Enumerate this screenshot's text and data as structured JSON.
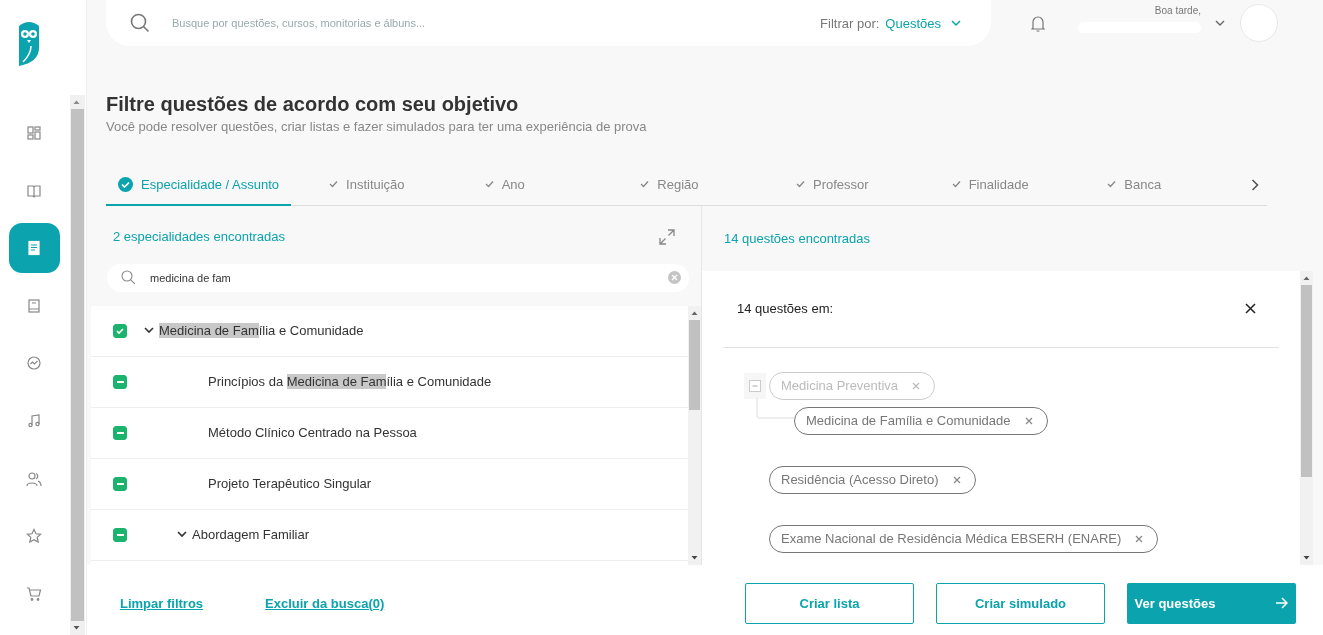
{
  "sidebar": {
    "items": [
      {
        "selected": false
      },
      {
        "selected": false
      },
      {
        "selected": true
      },
      {
        "selected": false
      },
      {
        "selected": false
      },
      {
        "selected": false
      },
      {
        "selected": false
      },
      {
        "selected": false
      },
      {
        "selected": false
      }
    ]
  },
  "top_bar": {
    "search": {
      "placeholder": "Busque por questões, cursos, monitorias e álbuns..."
    },
    "filter_label": "Filtrar por:",
    "filter_value": "Questões",
    "greeting": "Boa tarde,"
  },
  "page": {
    "title": "Filtre questões de acordo com seu objetivo",
    "subtitle": "Você pode resolver questões, criar listas e fazer simulados para ter uma experiência de prova"
  },
  "tabs": [
    {
      "label": "Especialidade / Assunto",
      "selected": true
    },
    {
      "label": "Instituição",
      "selected": false
    },
    {
      "label": "Ano",
      "selected": false
    },
    {
      "label": "Região",
      "selected": false
    },
    {
      "label": "Professor",
      "selected": false
    },
    {
      "label": "Finalidade",
      "selected": false
    },
    {
      "label": "Banca",
      "selected": false
    }
  ],
  "left_panel": {
    "count": "2 especialidades encontradas",
    "search": {
      "value": "medicina de fam"
    },
    "tree": [
      {
        "checked": true,
        "partial": false,
        "expanded": true,
        "label": [
          {
            "text": "Medicina de Fam",
            "highlighted": true
          },
          {
            "text": "ília e Comunidade",
            "highlighted": false
          }
        ],
        "children": [
          {
            "checked": true,
            "partial": true,
            "label": [
              {
                "text": "Princípios da ",
                "highlighted": false
              },
              {
                "text": "Medicina de Fam",
                "highlighted": true
              },
              {
                "text": "ília e Comunidade",
                "highlighted": false
              }
            ]
          },
          {
            "checked": true,
            "partial": true,
            "label": [
              {
                "text": "Método Clínico Centrado na Pessoa",
                "highlighted": false
              }
            ]
          },
          {
            "checked": true,
            "partial": true,
            "label": [
              {
                "text": "Projeto Terapêutico Singular",
                "highlighted": false
              }
            ]
          },
          {
            "checked": true,
            "partial": true,
            "expanded": true,
            "label": [
              {
                "text": "Abordagem Familiar",
                "highlighted": false
              }
            ]
          }
        ]
      }
    ]
  },
  "right_panel": {
    "count": "14 questões encontradas",
    "card_title": "14 questões em:",
    "tags": [
      {
        "label": "Medicina Preventiva",
        "dimmed": true,
        "expanded": true,
        "children": [
          {
            "label": "Medicina de Família e Comunidade",
            "dimmed": false
          }
        ]
      },
      {
        "label": "Residência (Acesso Direto)",
        "dimmed": false
      },
      {
        "label": "Exame Nacional de Residência Médica EBSERH (ENARE)",
        "dimmed": false
      }
    ]
  },
  "footer": {
    "links": [
      "Limpar filtros",
      "Excluir da busca(0)"
    ],
    "buttons": [
      {
        "label": "Criar lista",
        "kind": "outline"
      },
      {
        "label": "Criar simulado",
        "kind": "outline"
      },
      {
        "label": "Ver questões",
        "kind": "primary"
      }
    ]
  }
}
